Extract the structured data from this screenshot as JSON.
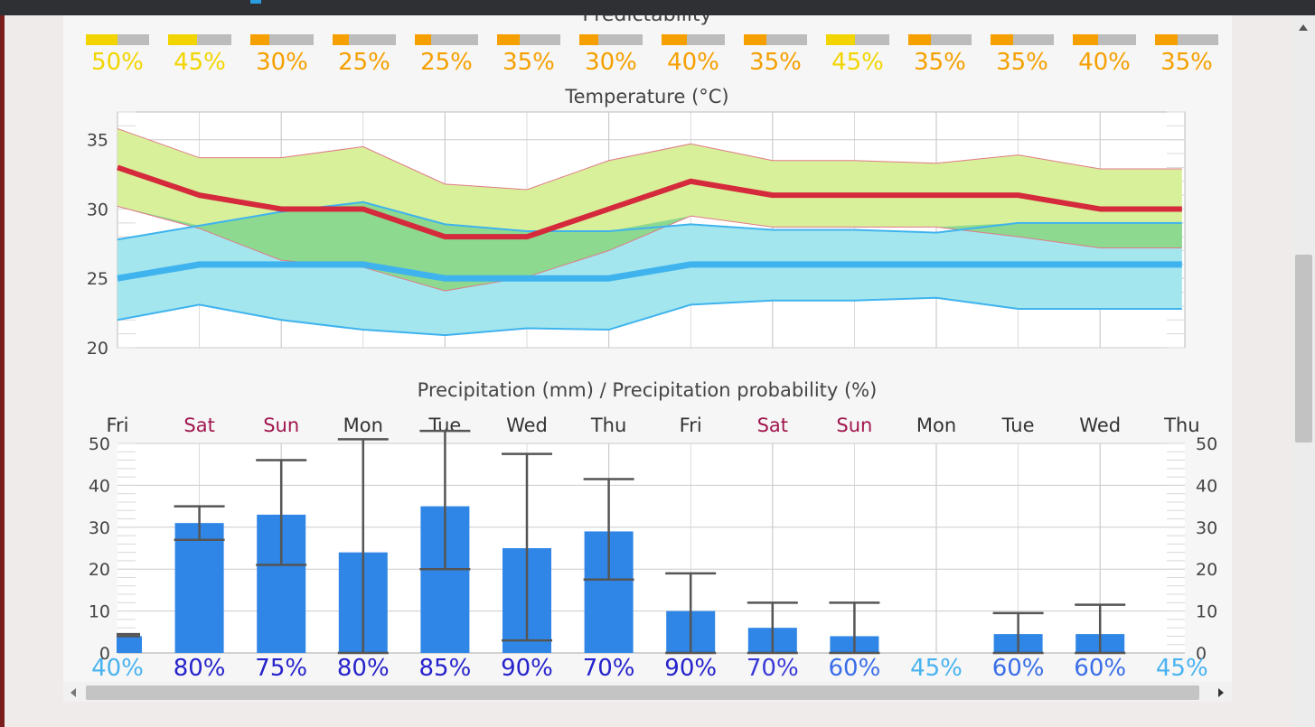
{
  "predictability": {
    "title": "Predictability",
    "values": [
      "50%",
      "45%",
      "30%",
      "25%",
      "25%",
      "35%",
      "30%",
      "40%",
      "35%",
      "45%",
      "35%",
      "35%",
      "40%",
      "35%"
    ],
    "fractions": [
      0.5,
      0.45,
      0.3,
      0.25,
      0.25,
      0.35,
      0.3,
      0.4,
      0.35,
      0.45,
      0.35,
      0.35,
      0.4,
      0.35
    ],
    "text_colors": [
      "#f2d500",
      "#f2d500",
      "#f5a000",
      "#f5a000",
      "#f5a000",
      "#f5a000",
      "#f5a000",
      "#f5a000",
      "#f5a000",
      "#f2d500",
      "#f5a000",
      "#f5a000",
      "#f5a000",
      "#f5a000"
    ]
  },
  "colors": {
    "max_band": "#d9f09a",
    "min_band": "#a3e6ee",
    "overlap_band": "#8dd98f",
    "max_line": "#d42a3c",
    "min_line": "#3fb3ee",
    "bar": "#2f86e6",
    "whisker": "#555555",
    "weekday": "#333333",
    "weekend": "#a0164e",
    "bar_gray": "#bcbcbc"
  },
  "chart_data": [
    {
      "type": "line",
      "title": "Temperature (°C)",
      "ylim": [
        20,
        37
      ],
      "yticks": [
        20,
        25,
        30,
        35
      ],
      "grid": true,
      "x": [
        0,
        1,
        2,
        3,
        4,
        5,
        6,
        7,
        8,
        9,
        10,
        11,
        12,
        13
      ],
      "series": [
        {
          "values": [
            33,
            31,
            30,
            30,
            28,
            28,
            30,
            32,
            31,
            31,
            31,
            31,
            30,
            30
          ]
        },
        {
          "values": [
            35.8,
            33.7,
            33.7,
            34.5,
            31.8,
            31.4,
            33.5,
            34.7,
            33.5,
            33.5,
            33.3,
            33.9,
            32.9,
            32.9
          ]
        },
        {
          "values": [
            30.2,
            28.6,
            26.3,
            25.8,
            24.1,
            25.1,
            27.0,
            29.5,
            28.7,
            28.7,
            28.7,
            28.0,
            27.2,
            27.2
          ]
        },
        {
          "values": [
            25,
            26,
            26,
            26,
            25,
            25,
            25,
            26,
            26,
            26,
            26,
            26,
            26,
            26
          ]
        },
        {
          "values": [
            27.8,
            28.8,
            29.8,
            30.5,
            28.9,
            28.4,
            28.4,
            28.9,
            28.5,
            28.5,
            28.3,
            29.0,
            29.0,
            29.0
          ]
        },
        {
          "values": [
            22.0,
            23.1,
            22.0,
            21.3,
            20.9,
            21.4,
            21.3,
            23.1,
            23.4,
            23.4,
            23.6,
            22.8,
            22.8,
            22.8
          ]
        }
      ]
    },
    {
      "type": "bar",
      "title": "Precipitation (mm) / Precipitation probability (%)",
      "categories": [
        "Fri",
        "Sat",
        "Sun",
        "Mon",
        "Tue",
        "Wed",
        "Thu",
        "Fri",
        "Sat",
        "Sun",
        "Mon",
        "Tue",
        "Wed",
        "Thu"
      ],
      "weekend": [
        false,
        true,
        true,
        false,
        false,
        false,
        false,
        false,
        true,
        true,
        false,
        false,
        false,
        false
      ],
      "values": [
        4,
        31,
        33,
        24,
        35,
        25,
        29,
        10,
        6,
        4,
        0,
        4.5,
        4.5,
        0
      ],
      "whisker_low": [
        4,
        27,
        21,
        0,
        20,
        3,
        17.5,
        0,
        0,
        0,
        null,
        0,
        0,
        null
      ],
      "whisker_high": [
        4.5,
        35,
        46,
        51,
        53,
        47.5,
        41.5,
        19,
        12,
        12,
        null,
        9.5,
        11.5,
        null
      ],
      "probabilities": [
        "40%",
        "80%",
        "75%",
        "80%",
        "85%",
        "90%",
        "70%",
        "90%",
        "70%",
        "60%",
        "45%",
        "60%",
        "60%",
        "45%"
      ],
      "probability_colors": [
        "#49b3f0",
        "#2623cc",
        "#2623cc",
        "#2623cc",
        "#2623cc",
        "#2623cc",
        "#2623cc",
        "#2623cc",
        "#3a3ad8",
        "#3a6ee8",
        "#49b3f0",
        "#3a6ee8",
        "#3a6ee8",
        "#49b3f0"
      ],
      "ylim": [
        0,
        50
      ],
      "yticks": [
        0,
        10,
        20,
        30,
        40,
        50
      ],
      "grid": true
    }
  ]
}
